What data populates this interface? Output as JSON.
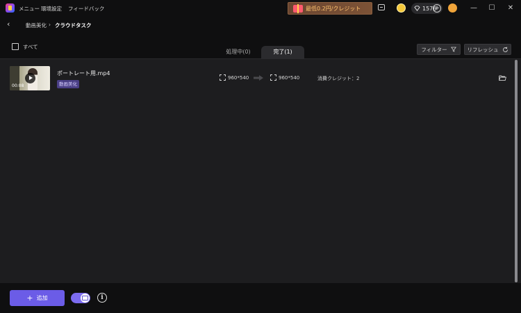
{
  "titlebar": {
    "menu_items": [
      "メニュー",
      "環境設定",
      "フィードバック"
    ],
    "promo_text": "最低0.2円/クレジット",
    "credits": "1576",
    "window": {
      "minimize": "—",
      "maximize": "☐",
      "close": "✕"
    }
  },
  "breadcrumb": {
    "back": "‹",
    "items": [
      "動画美化",
      "クラウドタスク"
    ],
    "separator": "›"
  },
  "task_panel": {
    "select_all_label": "すべて",
    "tabs": [
      {
        "label": "処理中(0)",
        "active": false
      },
      {
        "label": "完了(1)",
        "active": true
      }
    ],
    "filter_label": "フィルター",
    "refresh_label": "リフレッシュ"
  },
  "tasks": [
    {
      "file_name": "ポートレート用.mp4",
      "duration": "00:08",
      "tag": "動画美化",
      "input_resolution": "960*540",
      "output_resolution": "960*540",
      "cost": "消費クレジット：2"
    }
  ],
  "footer": {
    "add_label": "追加",
    "add_icon": "+",
    "info_icon": "i"
  },
  "colors": {
    "accent": "#6b5ce7",
    "tag_bg": "#4a3f86",
    "promo_text": "#ffc36e",
    "panel_bg": "#1d1d1f"
  }
}
